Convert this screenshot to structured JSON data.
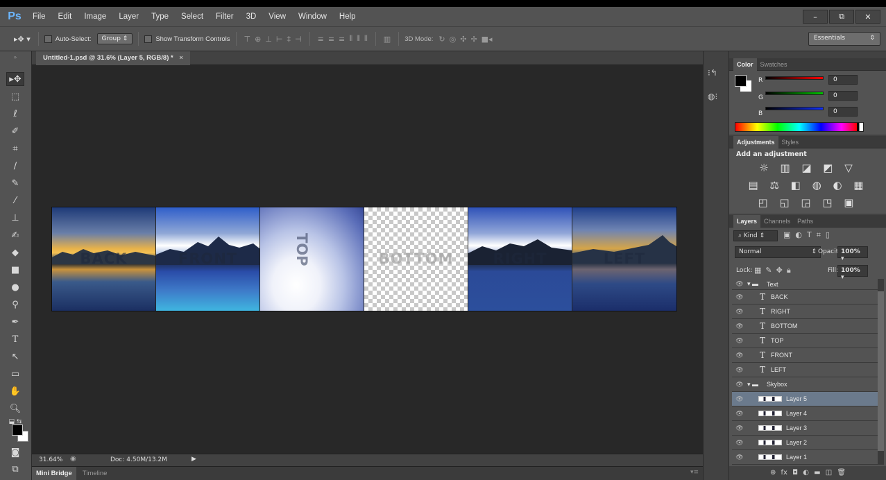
{
  "app": {
    "logo": "Ps"
  },
  "menu": [
    "File",
    "Edit",
    "Image",
    "Layer",
    "Type",
    "Select",
    "Filter",
    "3D",
    "View",
    "Window",
    "Help"
  ],
  "window_controls": {
    "minimize": "–",
    "restore": "⧉",
    "close": "✕"
  },
  "options": {
    "auto_select_label": "Auto-Select:",
    "auto_select_value": "Group",
    "transform_label": "Show Transform Controls",
    "mode3d_label": "3D Mode:",
    "workspace": "Essentials"
  },
  "document": {
    "tab_title": "Untitled-1.psd @ 31.6% (Layer 5, RGB/8) *",
    "zoom": "31.64%",
    "doc_size": "Doc: 4.50M/13.2M",
    "faces": [
      "BACK",
      "FRONT",
      "TOP",
      "BOTTOM",
      "RIGHT",
      "LEFT"
    ]
  },
  "bottom_tabs": [
    "Mini Bridge",
    "Timeline"
  ],
  "color_panel": {
    "tabs": [
      "Color",
      "Swatches"
    ],
    "r_label": "R",
    "g_label": "G",
    "b_label": "B",
    "r": "0",
    "g": "0",
    "b": "0",
    "colors": {
      "r": "#ff0000",
      "g": "#00c000",
      "b": "#1030ff"
    }
  },
  "adjustments_panel": {
    "tabs": [
      "Adjustments",
      "Styles"
    ],
    "heading": "Add an adjustment",
    "icons_row1": "☼ ▥ ◪ ◩ ▽",
    "icons_row2": "▤ ⚖ ◧ ◍ ◐ ▦",
    "icons_row3": "◰ ◱ ◲ ◳ ▣"
  },
  "layers_panel": {
    "tabs": [
      "Layers",
      "Channels",
      "Paths"
    ],
    "kind": "Kind",
    "blend_mode": "Normal",
    "opacity_label": "Opacity:",
    "opacity": "100%",
    "lock_label": "Lock:",
    "fill_label": "Fill:",
    "fill": "100%",
    "layers": [
      {
        "name": "Text",
        "kind": "group"
      },
      {
        "name": "BACK",
        "kind": "text"
      },
      {
        "name": "RIGHT",
        "kind": "text"
      },
      {
        "name": "BOTTOM",
        "kind": "text"
      },
      {
        "name": "TOP",
        "kind": "text"
      },
      {
        "name": "FRONT",
        "kind": "text"
      },
      {
        "name": "LEFT",
        "kind": "text"
      },
      {
        "name": "Skybox",
        "kind": "group"
      },
      {
        "name": "Layer 5",
        "kind": "pixel",
        "selected": true
      },
      {
        "name": "Layer 4",
        "kind": "pixel"
      },
      {
        "name": "Layer 3",
        "kind": "pixel"
      },
      {
        "name": "Layer 2",
        "kind": "pixel"
      },
      {
        "name": "Layer 1",
        "kind": "pixel"
      }
    ],
    "footer_icons": "⊕  fx  ◘  ◐  ▬  ◫  🗑"
  }
}
